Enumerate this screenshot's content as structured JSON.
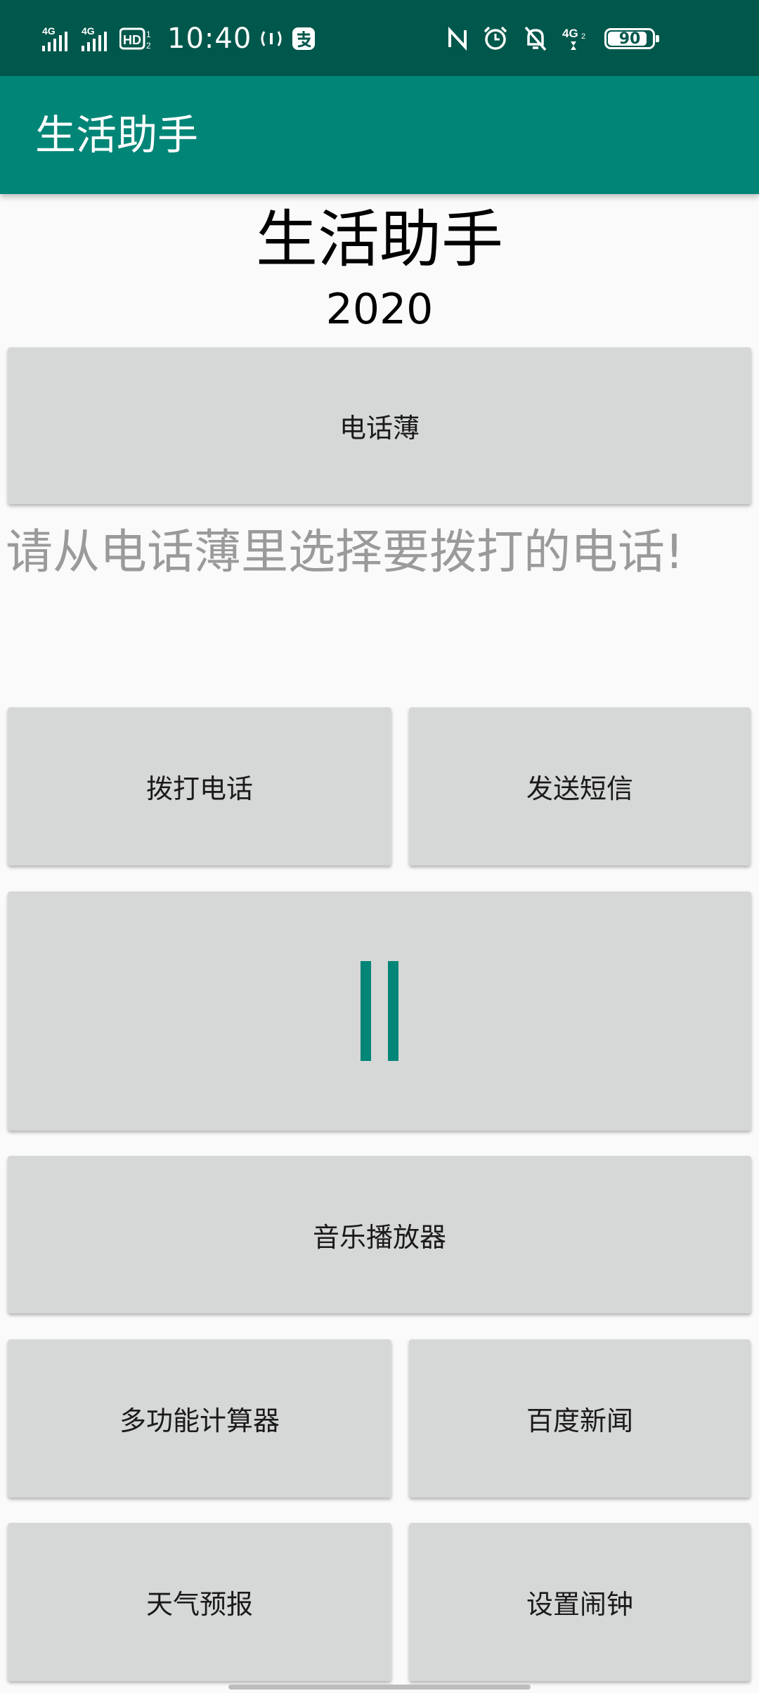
{
  "status_bar": {
    "time": "10:40",
    "signal1_label": "4G",
    "signal2_label": "4G",
    "hd_label": "HD",
    "net_label": "4G",
    "battery": "90",
    "battery_level": 0.9
  },
  "app_bar": {
    "title": "生活助手"
  },
  "header": {
    "title": "生活助手",
    "year": "2020"
  },
  "buttons": {
    "contacts": "电话薄",
    "hint": "请从电话薄里选择要拨打的电话!",
    "dial": "拨打电话",
    "sms": "发送短信",
    "music": "音乐播放器",
    "calculator": "多功能计算器",
    "news": "百度新闻",
    "weather": "天气预报",
    "alarm": "设置闹钟"
  },
  "colors": {
    "status_bar": "#00574b",
    "app_bar": "#008577",
    "accent": "#008577",
    "button_bg": "#d6d7d7",
    "hint_text": "#9a9a9a"
  },
  "icons": {
    "pause": "pause-icon",
    "nfc": "nfc-icon",
    "alarm": "alarm-clock-icon",
    "mute": "bell-off-icon",
    "hotspot": "hotspot-icon",
    "pay": "alipay-icon"
  }
}
